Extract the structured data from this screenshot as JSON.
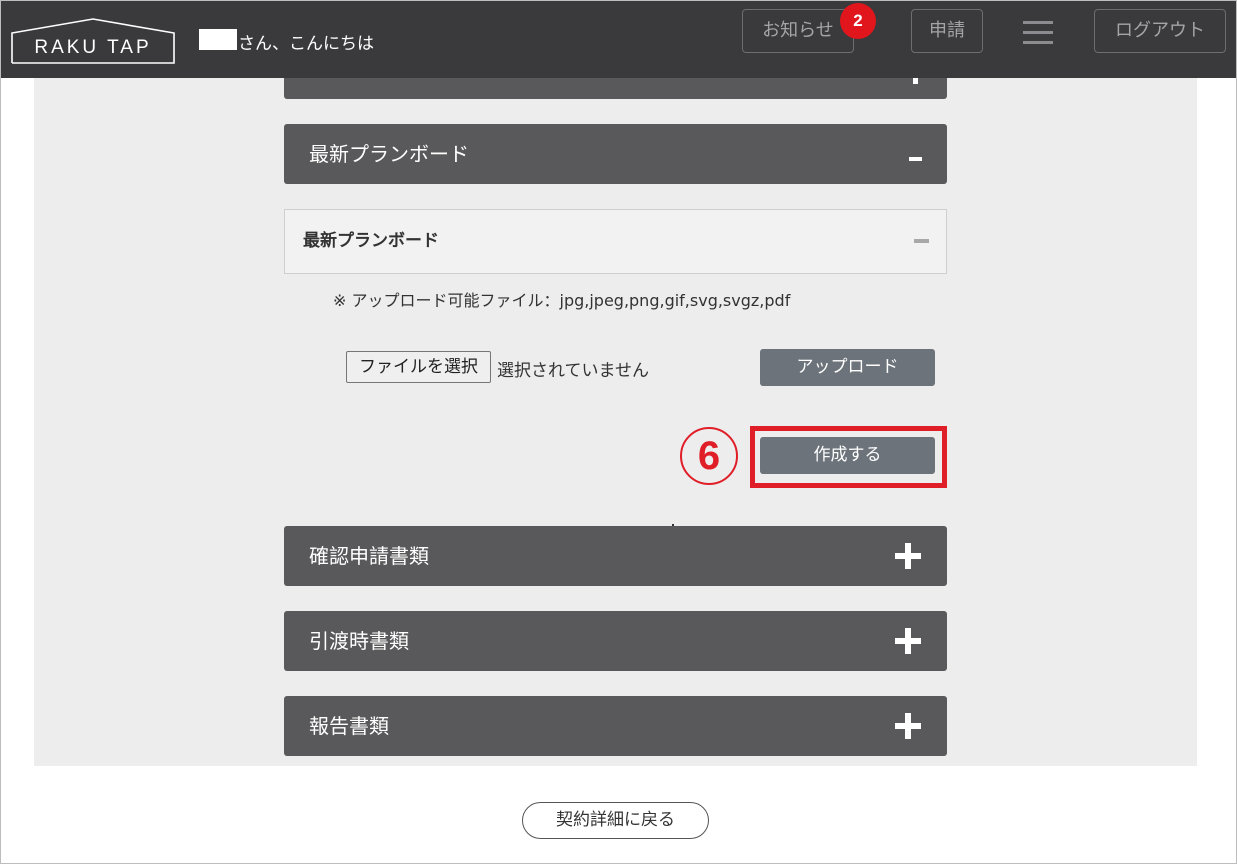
{
  "header": {
    "logo_text": "RAKU TAP",
    "greeting": "さん、こんにちは",
    "notice_label": "お知らせ",
    "notice_badge": "2",
    "apply_label": "申請",
    "logout_label": "ログアウト",
    "menu_icon": "hamburger-icon"
  },
  "sections": {
    "latest_plan_board": {
      "title": "最新プランボード",
      "state_icon": "minus-icon",
      "sub_title": "最新プランボード",
      "note": "※ アップロード可能ファイル：jpg,jpeg,png,gif,svg,svgz,pdf",
      "file_button": "ファイルを選択",
      "file_status": "選択されていません",
      "upload_label": "アップロード",
      "create_label": "作成する",
      "step_marker": "6"
    },
    "confirm_docs": {
      "title": "確認申請書類",
      "state_icon": "plus-icon"
    },
    "handover_docs": {
      "title": "引渡時書類",
      "state_icon": "plus-icon"
    },
    "report_docs": {
      "title": "報告書類",
      "state_icon": "plus-icon"
    }
  },
  "footer": {
    "back_label": "契約詳細に戻る"
  },
  "colors": {
    "header_bg": "#3a3a3d",
    "bar_bg": "#59595b",
    "button_gray": "#6c737a",
    "highlight_red": "#e01e28",
    "badge_red": "#e0161c"
  }
}
